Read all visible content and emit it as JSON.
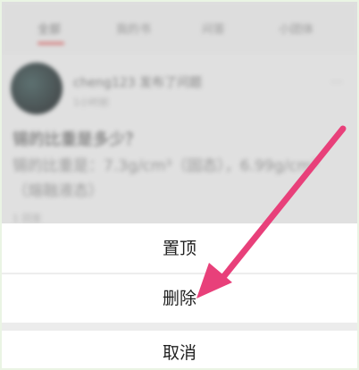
{
  "tabs": [
    {
      "label": "全部",
      "active": true
    },
    {
      "label": "我的书",
      "active": false
    },
    {
      "label": "问答",
      "active": false
    },
    {
      "label": "小团体",
      "active": false
    }
  ],
  "post": {
    "user": "cheng123 发布了问题",
    "time": "1小时前",
    "title": "锡的比重是多少？",
    "body": "锡的比重是：7.3g/cm³（固态），6.99g/cm³（熔融液态）",
    "footer": "1 回答"
  },
  "action_sheet": {
    "pin_label": "置顶",
    "delete_label": "删除",
    "cancel_label": "取消"
  },
  "colors": {
    "arrow": "#e8407a",
    "tab_accent": "#e65a5a"
  }
}
